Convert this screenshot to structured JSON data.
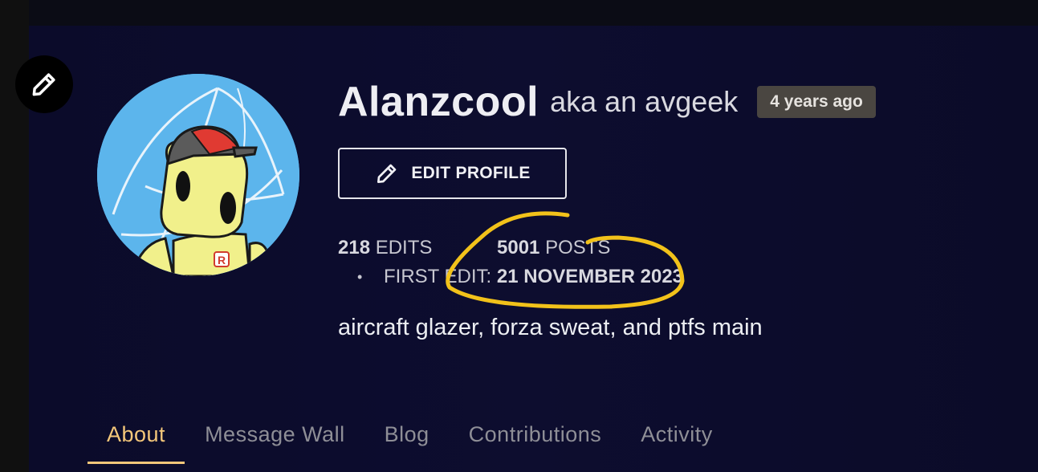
{
  "profile": {
    "username": "Alanzcool",
    "aka": "aka an avgeek",
    "age_badge": "4 years ago",
    "edit_profile_label": "EDIT PROFILE",
    "edits_count": "218",
    "edits_label": "EDITS",
    "posts_count": "5001",
    "posts_label": "POSTS",
    "bullet": "•",
    "first_edit_label": "FIRST EDIT:",
    "first_edit_date": "21 NOVEMBER 2023",
    "bio": "aircraft glazer, forza sweat, and ptfs main"
  },
  "tabs": [
    {
      "label": "About",
      "active": true
    },
    {
      "label": "Message Wall",
      "active": false
    },
    {
      "label": "Blog",
      "active": false
    },
    {
      "label": "Contributions",
      "active": false
    },
    {
      "label": "Activity",
      "active": false
    }
  ],
  "icons": {
    "avatar_edit": "pencil-icon",
    "edit_profile": "pencil-icon"
  },
  "colors": {
    "accent_tab": "#f4c77a",
    "annotation": "#f2c21a",
    "badge_bg": "#4a4641",
    "panel_bg": "#0d0d2f"
  }
}
